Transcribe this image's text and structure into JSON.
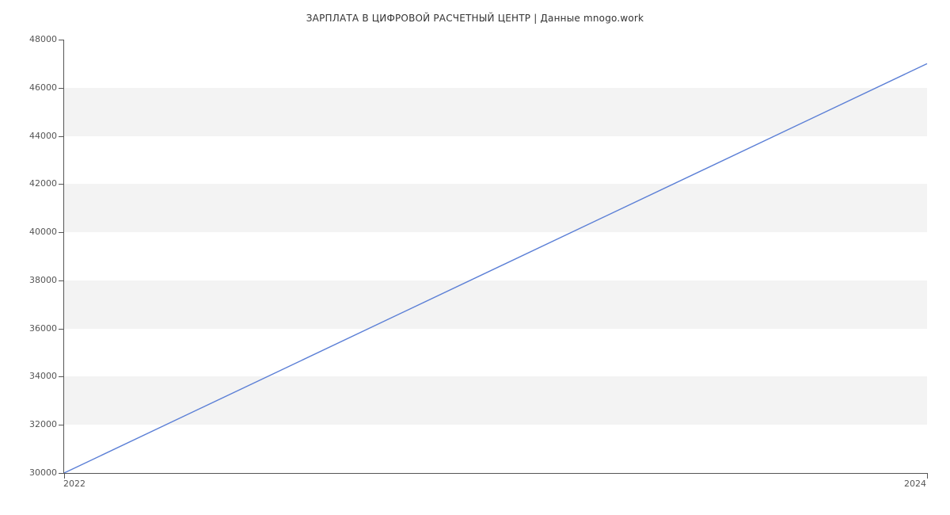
{
  "chart_data": {
    "type": "line",
    "title": "ЗАРПЛАТА В  ЦИФРОВОЙ РАСЧЕТНЫЙ ЦЕНТР  | Данные mnogo.work",
    "xlabel": "",
    "ylabel": "",
    "x": [
      2022,
      2024
    ],
    "values": [
      30000,
      47000
    ],
    "ylim": [
      30000,
      48000
    ],
    "xlim": [
      2022,
      2024
    ],
    "y_ticks": [
      30000,
      32000,
      34000,
      36000,
      38000,
      40000,
      42000,
      44000,
      46000,
      48000
    ],
    "x_ticks": [
      2022,
      2024
    ],
    "line_color": "#5b7fd6",
    "band_color": "#f3f3f3"
  }
}
